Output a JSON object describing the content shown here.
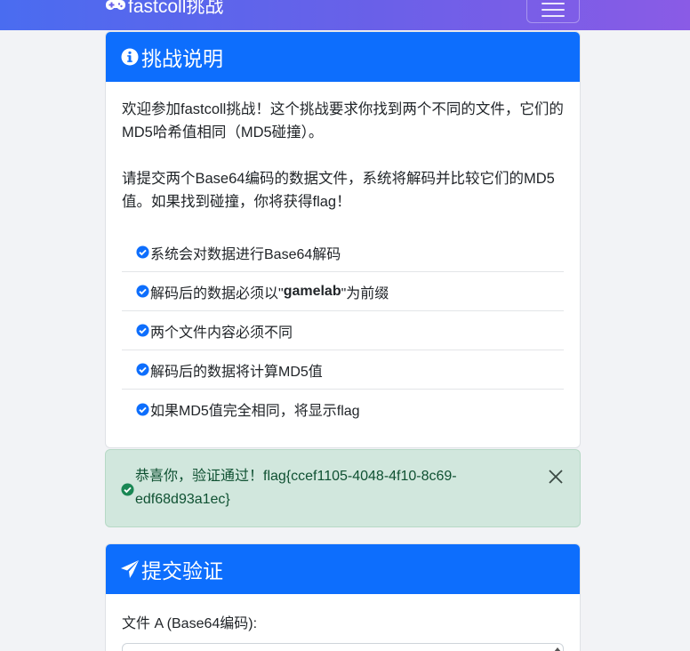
{
  "navbar": {
    "brand": "fastcoll挑战",
    "brand_icon": "gamepad-icon",
    "toggler_icon": "hamburger-menu-icon"
  },
  "instructions": {
    "title": "挑战说明",
    "title_icon": "info-circle-icon",
    "paragraph1": "欢迎参加fastcoll挑战！这个挑战要求你找到两个不同的文件，它们的MD5哈希值相同（MD5碰撞）。",
    "paragraph2": "请提交两个Base64编码的数据文件，系统将解码并比较它们的MD5值。如果找到碰撞，你将获得flag！",
    "rules": [
      {
        "text": "系统会对数据进行Base64解码"
      },
      {
        "pre": "解码后的数据必须以\"",
        "bold": "gamelab",
        "post": "\"为前缀"
      },
      {
        "text": "两个文件内容必须不同"
      },
      {
        "text": "解码后的数据将计算MD5值"
      },
      {
        "text": "如果MD5值完全相同，将显示flag"
      }
    ],
    "rule_icon": "check-circle-icon"
  },
  "alert": {
    "message": "恭喜你，验证通过！flag{ccef1105-4048-4f10-8c69-edf68d93a1ec}",
    "icon": "check-circle-icon",
    "close_icon": "close-icon",
    "colors": {
      "background": "#d1e7dd",
      "text": "#0f5132"
    }
  },
  "submit": {
    "title": "提交验证",
    "title_icon": "paper-plane-icon",
    "file_a_label": "文件 A (Base64编码):"
  },
  "colors": {
    "primary": "#0d6efd",
    "navbar_start": "#4a6cf0",
    "navbar_end": "#8a5be6"
  }
}
